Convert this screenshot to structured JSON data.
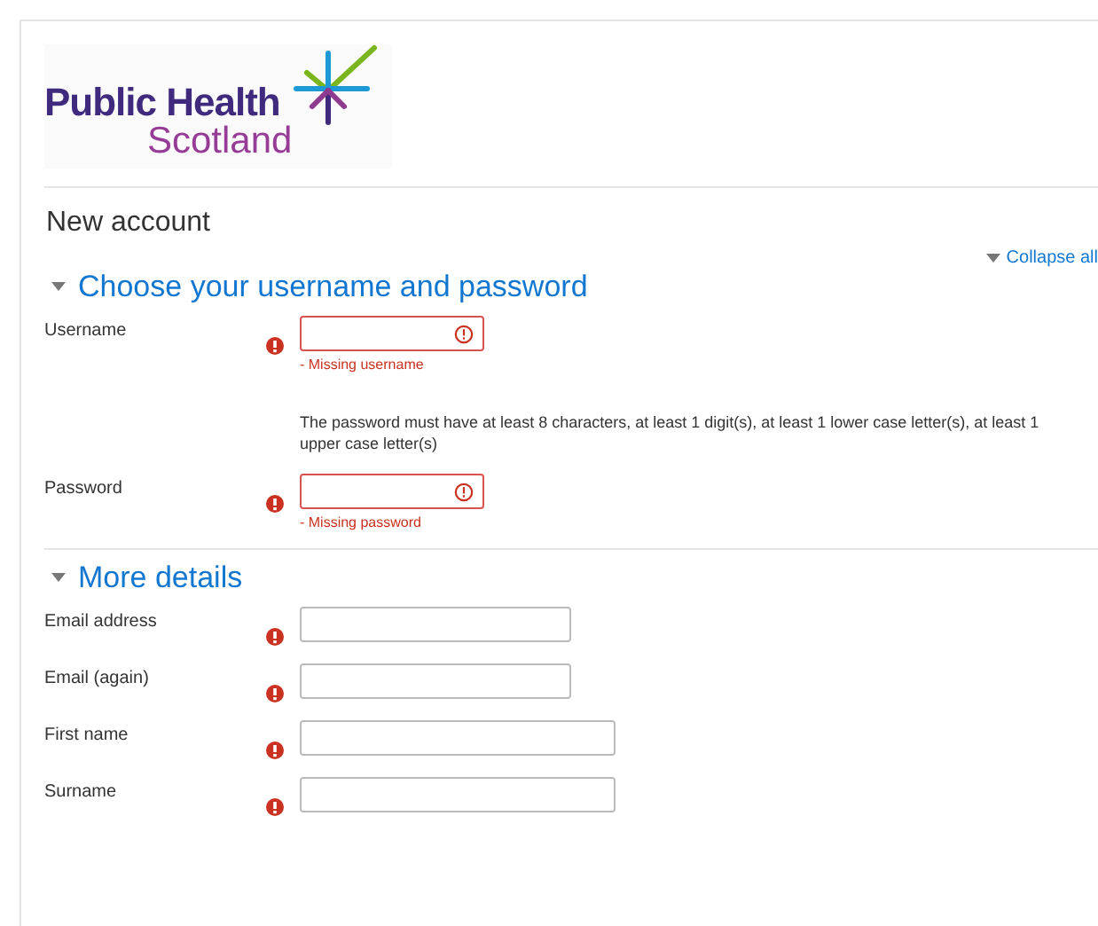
{
  "logo": {
    "line_1": "Public Health",
    "line_2": "Scotland"
  },
  "page_title": "New account",
  "collapse_all": "Collapse all",
  "sections": [
    {
      "title": "Choose your username and password",
      "expanded": true,
      "fields": [
        {
          "label": "Username",
          "required": true,
          "invalid": true,
          "error": "- Missing username"
        },
        {
          "label": "Password",
          "required": true,
          "invalid": true,
          "hint": "The password must have at least 8 characters, at least 1 digit(s), at least 1 lower case letter(s), at least 1 upper case letter(s)",
          "error": "- Missing password"
        }
      ]
    },
    {
      "title": "More details",
      "expanded": true,
      "fields": [
        {
          "label": "Email address",
          "required": true,
          "invalid": false
        },
        {
          "label": "Email (again)",
          "required": true,
          "invalid": false
        },
        {
          "label": "First name",
          "required": true,
          "invalid": false
        },
        {
          "label": "Surname",
          "required": true,
          "invalid": false
        }
      ]
    }
  ]
}
